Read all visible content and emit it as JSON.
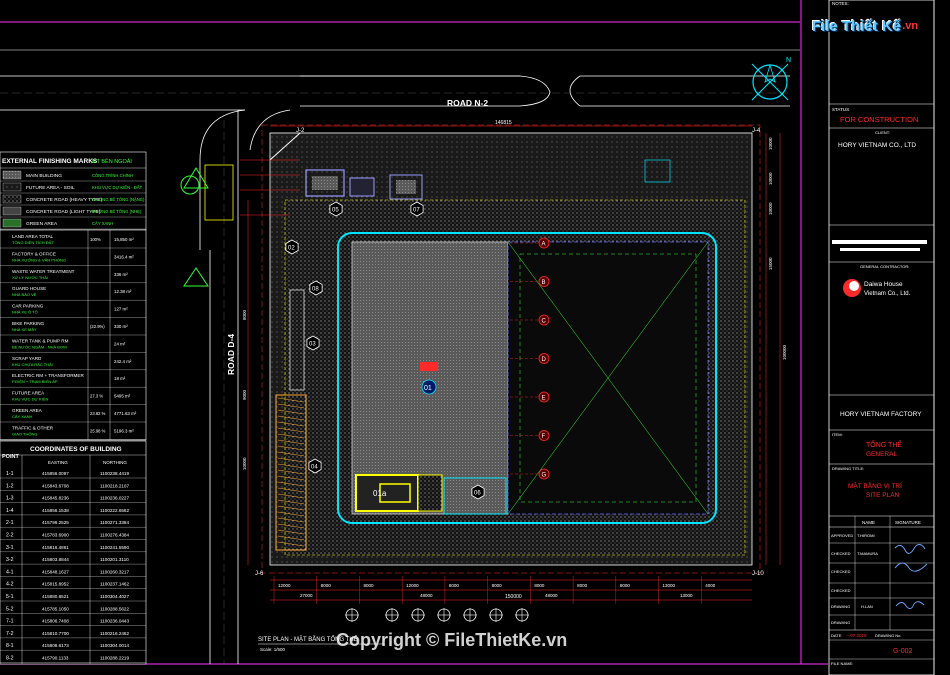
{
  "watermark": {
    "brand": "File Thiết Kế",
    "brand_suffix": ".vn",
    "copyright": "Copyright © FileThietKe.vn"
  },
  "colors": {
    "background": "#000000",
    "cyan": "#00e5ff",
    "red": "#ff2a2a",
    "yellow": "#ffff00",
    "green": "#33ff33",
    "magenta": "#ff33ff",
    "white": "#ffffff",
    "gray": "#9a9a9a",
    "orange": "#ff9900"
  },
  "roads": {
    "north": "ROAD N-2",
    "west": "ROAD D-4"
  },
  "legend": {
    "title": "EXTERNAL FINISHING MARKS",
    "title_vn": "MT BÊN NGOÀI",
    "rows": [
      {
        "name": "MAIN BUILDING",
        "vn": "CÔNG TRÌNH CHÍNH"
      },
      {
        "name": "FUTURE AREA - SOIL",
        "vn": "KHU VỰC DỰ KIẾN - ĐẤT"
      },
      {
        "name": "CONCRETE ROAD (HEAVY TYPE)",
        "vn": "ĐƯỜNG BÊ TÔNG (NẶNG)"
      },
      {
        "name": "CONCRETE ROAD (LIGHT TYPE)",
        "vn": "ĐƯỜNG BÊ TÔNG (NHẸ)"
      },
      {
        "name": "GREEN AREA",
        "vn": "CÂY XANH"
      }
    ]
  },
  "area_table": [
    {
      "name": "LAND AREA TOTAL",
      "vn": "TỔNG DIỆN TÍCH ĐẤT",
      "pct": "100%",
      "value": "15,850 m²"
    },
    {
      "name": "FACTORY & OFFICE",
      "vn": "NHÀ XƯỞNG & VĂN PHÒNG",
      "pct": "",
      "value": "3416.4 m²"
    },
    {
      "name": "WASTE WATER TREATMENT",
      "vn": "XỬ LÝ NƯỚC THẢI",
      "pct": "",
      "value": "336 m²"
    },
    {
      "name": "GUARD HOUSE",
      "vn": "NHÀ BẢO VỆ",
      "pct": "",
      "value": "12.38 m²"
    },
    {
      "name": "CAR PARKING",
      "vn": "NHÀ XE Ô TÔ",
      "pct": "",
      "value": "127 m²"
    },
    {
      "name": "BIKE PARKING",
      "vn": "NHÀ XE MÁY",
      "pct": "(22.9%)",
      "value": "330 m²"
    },
    {
      "name": "WATER TANK & PUMP RM",
      "vn": "BỂ NƯỚC NGẦM - NHÀ BƠM",
      "pct": "",
      "value": "24 m²"
    },
    {
      "name": "SCRAP YARD",
      "vn": "KHU CHỨA RÁC THẢI",
      "pct": "",
      "value": "242.4 m²"
    },
    {
      "name": "ELECTRIC RM + TRANSFORMER",
      "vn": "P.ĐIỆN + TRẠM BIẾN ÁP",
      "pct": "",
      "value": "18 m²"
    },
    {
      "name": "FUTURE AREA",
      "vn": "KHU VỰC DỰ KIẾN",
      "pct": "27.3 %",
      "value": "5495 m²"
    },
    {
      "name": "GREEN AREA",
      "vn": "CÂY XANH",
      "pct": "23.82 %",
      "value": "4771.63 m²"
    },
    {
      "name": "TRAFFIC & OTHER",
      "vn": "GIAO THÔNG",
      "pct": "25.98 %",
      "value": "5196.3 m²"
    }
  ],
  "coords": {
    "title": "COORDINATES OF BUILDING",
    "col_point": "POINT",
    "col_easting": "EASTING",
    "col_northing": "NORTHING",
    "rows": [
      [
        "1-1",
        "415856.0097",
        "1100238.4419"
      ],
      [
        "1-2",
        "415843.6708",
        "1100218.2107"
      ],
      [
        "1-3",
        "415845.8236",
        "1100236.0227"
      ],
      [
        "1-4",
        "415856.1538",
        "1100222.6562"
      ],
      [
        "2-1",
        "415796.2525",
        "1100271.3384"
      ],
      [
        "2-2",
        "415783.6900",
        "1100276.4384"
      ],
      [
        "3-1",
        "415816.4861",
        "1100241.5590"
      ],
      [
        "3-2",
        "415803.8844",
        "1100201.3110"
      ],
      [
        "4-1",
        "415848.1627",
        "1100260.3217"
      ],
      [
        "4-2",
        "415815.8952",
        "1100237.1462"
      ],
      [
        "5-1",
        "415880.8521",
        "1100304.4027"
      ],
      [
        "5-2",
        "415785.1050",
        "1100288.5622"
      ],
      [
        "7-1",
        "415806.7408",
        "1100236.0443"
      ],
      [
        "7-2",
        "415810.7700",
        "1100216.2462"
      ],
      [
        "8-1",
        "415808.6173",
        "1100304.0014"
      ],
      [
        "8-2",
        "415790.1133",
        "1100288.2219"
      ]
    ]
  },
  "title_block": {
    "notes_label": "NOTES:",
    "status_label": "STATUS",
    "status": "FOR CONSTRUCTION",
    "client_label": "CLIENT:",
    "client": "HORY VIETNAM CO., LTD",
    "contractor_label": "GENERAL CONTRACTOR:",
    "contractor_1": "Daiwa House",
    "contractor_2": "Vietnam Co., Ltd.",
    "project": "HORY VIETNAM FACTORY",
    "item_label": "ITEM:",
    "item_vn": "TỔNG THỂ",
    "item_en": "GENERAL",
    "drawing_title_label": "DRAWING TITLE:",
    "drawing_title_vn": "MẶT BẰNG VỊ TRÍ",
    "drawing_title_en": "SITE PLAN",
    "name_label": "NAME",
    "signature_label": "SIGNATURE",
    "approved_label": "APPROVED",
    "approved_name": "T.HIROMI",
    "checked_label": "CHECKED",
    "checked_name": "T.MAMURA",
    "checked2_label": "CHECKED",
    "checked2_name": "",
    "checked3_label": "CHECKED",
    "drawing_label": "DRAWING",
    "drawing_name": "H.LAN",
    "drawing2_label": "DRAWING",
    "date_label": "DATE",
    "date": "--.07.2019",
    "drawing_no_label": "DRAWING No.",
    "drawing_no": "G-002",
    "file_label": "FILE NAME:"
  },
  "plan": {
    "sheet_caption": "SITE PLAN - MẶT BẰNG TỔNG THỂ",
    "scale": "Scale: 1/500",
    "building_tag": "01",
    "tags": [
      "01a",
      "02",
      "03",
      "04",
      "05",
      "06",
      "07",
      "08"
    ],
    "grid_rows": [
      "A",
      "B",
      "C",
      "D",
      "E",
      "F",
      "G"
    ],
    "corner_labels": [
      "J-2",
      "J-4",
      "J-6",
      "J-10"
    ],
    "dim_top": "146815",
    "dims_bottom": [
      "12000",
      "8000",
      "8000",
      "12000",
      "8000",
      "8000",
      "8000",
      "8000",
      "8000",
      "13000",
      "4000"
    ],
    "dim_bottom_total": "150000",
    "dim_bottom_mid": [
      "27000",
      "48000",
      "48000",
      "13000"
    ],
    "dims_right": [
      "10000",
      "10000",
      "10000",
      "15000",
      "100000"
    ],
    "dims_left": [
      "8000",
      "9000",
      "10000"
    ]
  }
}
